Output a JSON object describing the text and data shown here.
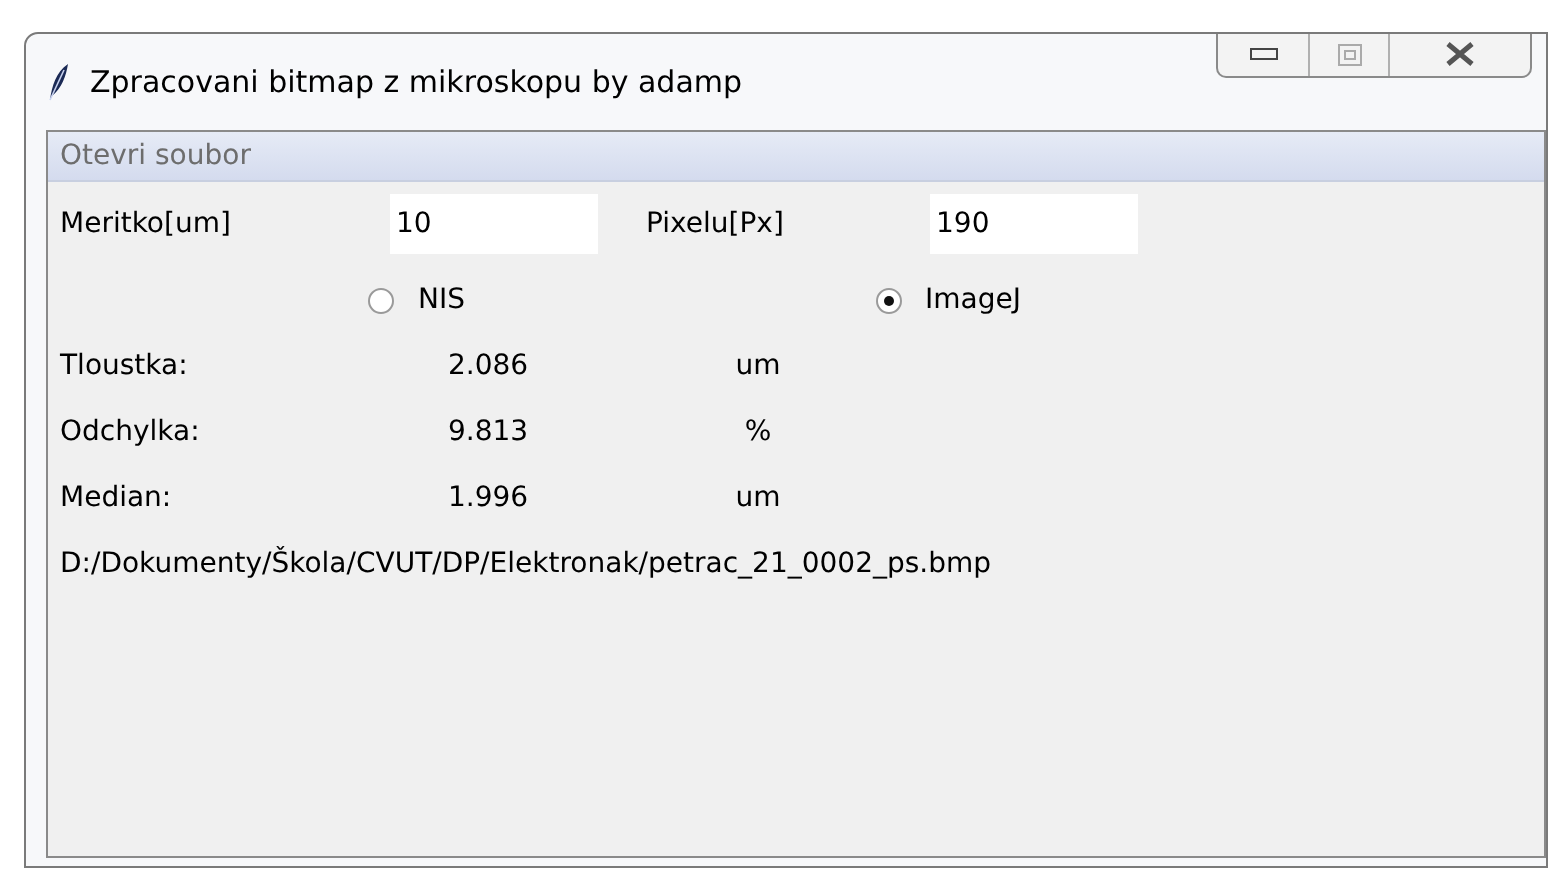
{
  "window": {
    "title": "Zpracovani bitmap z mikroskopu by adamp"
  },
  "menu": {
    "items": [
      "Otevri soubor"
    ]
  },
  "inputs": [
    {
      "label": "Meritko[um]",
      "value": "10"
    },
    {
      "label": "Pixelu[Px]",
      "value": "190"
    }
  ],
  "radios": [
    {
      "label": "NIS",
      "selected": false
    },
    {
      "label": "ImageJ",
      "selected": true
    }
  ],
  "results": [
    {
      "label": "Tloustka:",
      "value": "2.086",
      "unit": "um"
    },
    {
      "label": "Odchylka:",
      "value": "9.813",
      "unit": "%"
    },
    {
      "label": "Median:",
      "value": "1.996",
      "unit": "um"
    }
  ],
  "file_path": "D:/Dokumenty/Škola/CVUT/DP/Elektronak/petrac_21_0002_ps.bmp"
}
